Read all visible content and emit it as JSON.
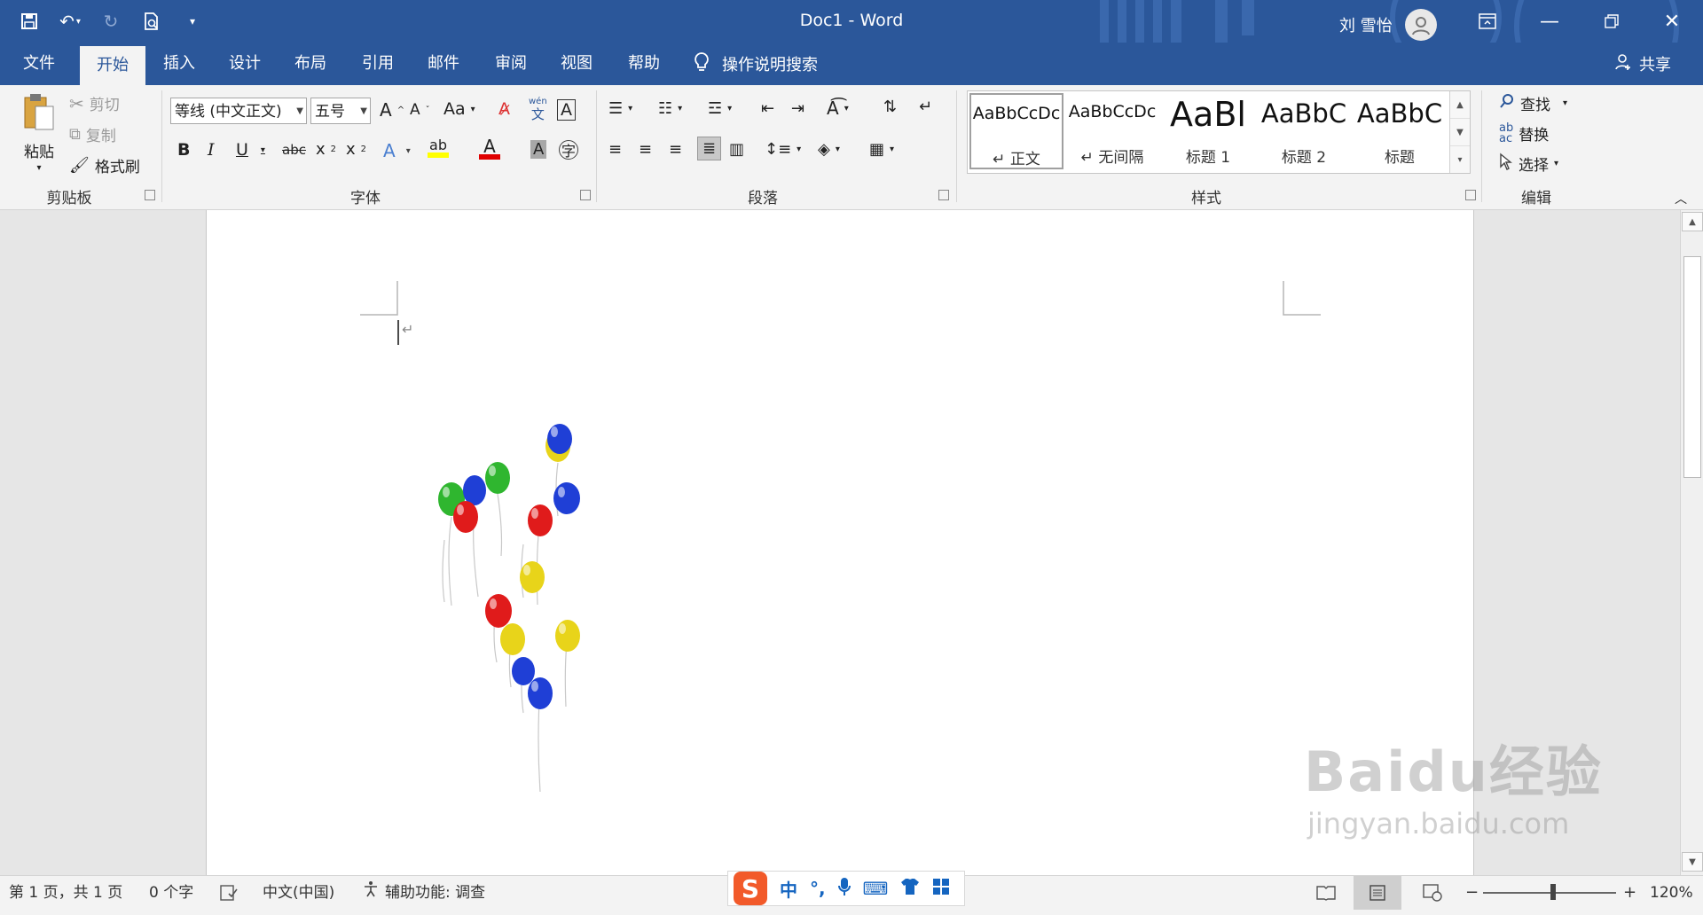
{
  "titlebar": {
    "doc_title": "Doc1  -  Word",
    "user_name": "刘 雪怡",
    "qat_icons": [
      "save-icon",
      "undo-icon",
      "redo-icon",
      "print-preview-icon",
      "customize-icon"
    ]
  },
  "tabs": [
    {
      "label": "文件",
      "active": false
    },
    {
      "label": "开始",
      "active": true
    },
    {
      "label": "插入",
      "active": false
    },
    {
      "label": "设计",
      "active": false
    },
    {
      "label": "布局",
      "active": false
    },
    {
      "label": "引用",
      "active": false
    },
    {
      "label": "邮件",
      "active": false
    },
    {
      "label": "审阅",
      "active": false
    },
    {
      "label": "视图",
      "active": false
    },
    {
      "label": "帮助",
      "active": false
    }
  ],
  "tell_me": "操作说明搜索",
  "share": "共享",
  "clipboard": {
    "group": "剪贴板",
    "paste": "粘贴",
    "cut": "剪切",
    "copy": "复制",
    "format_painter": "格式刷"
  },
  "font": {
    "group": "字体",
    "font_name": "等线 (中文正文)",
    "font_size": "五号"
  },
  "paragraph": {
    "group": "段落"
  },
  "styles": {
    "group": "样式",
    "items": [
      {
        "sample": "AaBbCcDc",
        "name": "↵ 正文"
      },
      {
        "sample": "AaBbCcDc",
        "name": "↵ 无间隔"
      },
      {
        "sample": "AaBl",
        "name": "标题 1"
      },
      {
        "sample": "AaBbC",
        "name": "标题 2"
      },
      {
        "sample": "AaBbC",
        "name": "标题"
      }
    ]
  },
  "editing": {
    "group": "编辑",
    "find": "查找",
    "replace": "替换",
    "select": "选择"
  },
  "status": {
    "page": "第 1 页，共 1 页",
    "words": "0 个字",
    "language": "中文(中国)",
    "accessibility": "辅助功能: 调查",
    "zoom": "120%"
  },
  "ime": {
    "mode": "中",
    "punct": "°,"
  },
  "watermark": {
    "line1": "Baidu经验",
    "line2": "jingyan.baidu.com"
  },
  "colors": {
    "accent": "#2b579a",
    "balloon_red": "#e01b1b",
    "balloon_blue": "#1f3fd6",
    "balloon_green": "#2fb62f",
    "balloon_yellow": "#e8d41a"
  }
}
